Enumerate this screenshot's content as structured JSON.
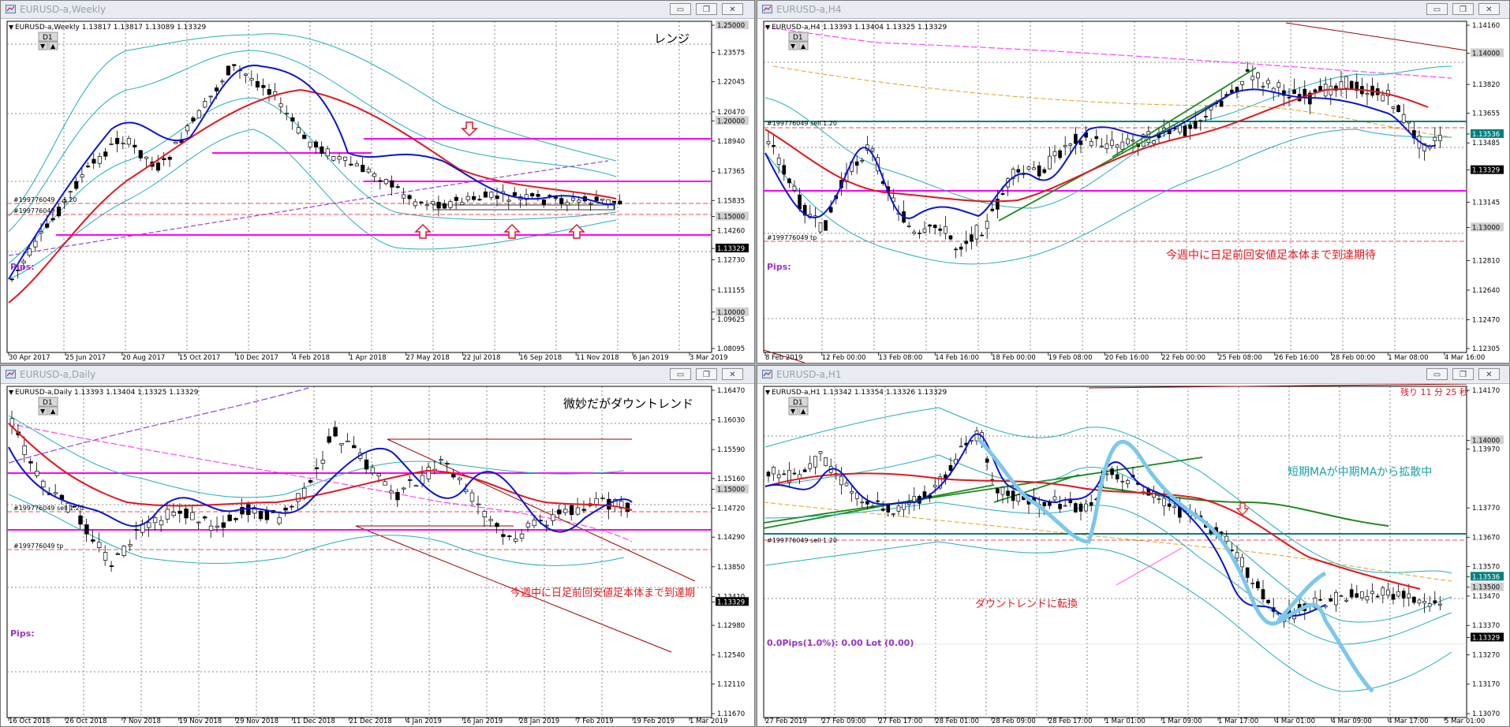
{
  "panels": [
    {
      "id": "weekly",
      "title": "EURUSD-a,Weekly",
      "info": "EURUSD-a,Weekly  1.13817 1.13817 1.13089 1.13329",
      "tf": "D1",
      "note": "レンジ",
      "note2": "",
      "prices": [
        "1.25000",
        "1.23575",
        "1.22045",
        "1.20470",
        "1.20000",
        "1.18940",
        "1.17365",
        "1.15835",
        "1.15000",
        "1.14260",
        "1.13329",
        "1.12730",
        "1.11155",
        "1.10000",
        "1.09625",
        "1.08095"
      ],
      "dates": [
        "30 Apr 2017",
        "25 Jun 2017",
        "20 Aug 2017",
        "15 Oct 2017",
        "10 Dec 2017",
        "4 Feb 2018",
        "1 Apr 2018",
        "27 May 2018",
        "22 Jul 2018",
        "16 Sep 2018",
        "11 Nov 2018",
        "6 Jan 2019",
        "3 Mar 2019"
      ],
      "order1": "#199776049 ...1.20",
      "order2": "#199776049 ...",
      "pips": "Pips:"
    },
    {
      "id": "h4",
      "title": "EURUSD-a,H4",
      "info": "EURUSD-a,H4  1.13393 1.13404 1.13325 1.13329",
      "tf": "D1",
      "note": "今週中に日足前回安値足本体まで到達期待",
      "note2": "",
      "prices": [
        "1.14160",
        "1.14000",
        "1.13820",
        "1.13655",
        "1.13536",
        "1.13485",
        "1.13329",
        "1.13145",
        "1.13000",
        "1.12810",
        "1.12640",
        "1.12470",
        "1.12305"
      ],
      "dates": [
        "8 Feb 2019",
        "12 Feb 00:00",
        "13 Feb 08:00",
        "14 Feb 16:00",
        "18 Feb 00:00",
        "19 Feb 08:00",
        "20 Feb 16:00",
        "22 Feb 00:00",
        "25 Feb 08:00",
        "26 Feb 16:00",
        "28 Feb 00:00",
        "1 Mar 08:00",
        "4 Mar 16:00"
      ],
      "order1": "#199776049 sell 1.20",
      "order2": "#199776049 tp",
      "pips": "Pips:"
    },
    {
      "id": "daily",
      "title": "EURUSD-a,Daily",
      "info": "EURUSD-a,Daily  1.13393 1.13404 1.13325 1.13329",
      "tf": "D1",
      "note": "微妙だがダウントレンド",
      "note2": "今週中に日足前回安値足本体まで到達期",
      "prices": [
        "1.16470",
        "1.16030",
        "1.15590",
        "1.15160",
        "1.15000",
        "1.14720",
        "1.14290",
        "1.13850",
        "1.13410",
        "1.13329",
        "1.12980",
        "1.12540",
        "1.12110",
        "1.11670"
      ],
      "dates": [
        "16 Oct 2018",
        "26 Oct 2018",
        "7 Nov 2018",
        "19 Nov 2018",
        "29 Nov 2018",
        "11 Dec 2018",
        "21 Dec 2018",
        "4 Jan 2019",
        "16 Jan 2019",
        "28 Jan 2019",
        "7 Feb 2019",
        "19 Feb 2019",
        "1 Mar 2019"
      ],
      "order1": "#199776049 sell 1.20",
      "order2": "#199776049 tp",
      "pips": "Pips:"
    },
    {
      "id": "h1",
      "title": "EURUSD-a,H1",
      "info": "EURUSD-a,H1  1.13342 1.13354 1.13326 1.13329",
      "tf": "D1",
      "note": "短期MAが中期MAから拡散中",
      "note2": "ダウントレンドに転換",
      "countdown": "残り 11 分 25 秒",
      "prices": [
        "1.14170",
        "1.14000",
        "1.13970",
        "1.13770",
        "1.13670",
        "1.13570",
        "1.13536",
        "1.13500",
        "1.13470",
        "1.13370",
        "1.13329",
        "1.13270",
        "1.13170",
        "1.13070"
      ],
      "dates": [
        "27 Feb 2019",
        "27 Feb 09:00",
        "27 Feb 17:00",
        "28 Feb 01:00",
        "28 Feb 09:00",
        "28 Feb 17:00",
        "1 Mar 01:00",
        "1 Mar 09:00",
        "1 Mar 17:00",
        "4 Mar 01:00",
        "4 Mar 09:00",
        "4 Mar 17:00",
        "5 Mar 01:00"
      ],
      "order1": "#199776049 sell 1.20",
      "order2": "",
      "pips": "0.0Pips(1.0%): 0.00 Lot (0.00)"
    }
  ],
  "colors": {
    "bull": "#000000",
    "bear": "#000000",
    "ma_red": "#e8141b",
    "ma_blue": "#0a14d8",
    "band": "#1fb0b8",
    "magenta": "#ff00ff",
    "teal": "#008080",
    "green": "#1a8a1a",
    "cyan_pred": "#7cc8ec",
    "arrow": "#e8141b",
    "note": "#e8141b",
    "pips": "#9933cc"
  },
  "icons": [
    "chart-window-icon",
    "minimize-icon",
    "restore-icon",
    "close-icon",
    "scroll-down-icon",
    "scroll-up-icon",
    "arrow-down-icon",
    "arrow-up-icon"
  ]
}
